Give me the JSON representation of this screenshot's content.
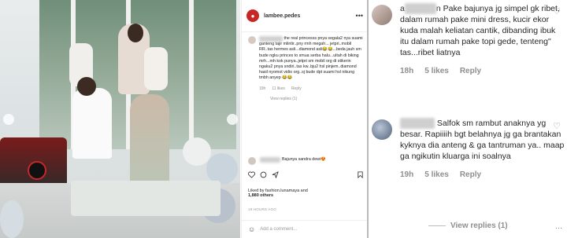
{
  "post": {
    "username": "lambee.pedes",
    "comments": [
      {
        "text": "the real princesss pnya segala2 nya suami ganteng tajir mlintir..pny rmh megah... jetpri..mobil RR..tas hermes asli...diamond asli😂😂...beda jauh sm bude ngku princes to smua serba halu...ultah di biking mrh...mh kok punya..jetpri sm mobil org di stikerin ngaku2 pnya sndiri..tas kw..bju2 hsl pinjem..diamond hasil nyomot vidio org..sj bude dpt suami hsl nikung tmbh anyep 😂😂",
        "meta": [
          "19h",
          "11 likes",
          "Reply"
        ],
        "view": "View replies (1)"
      },
      {
        "text": "Bajunya sandra dewi😍",
        "meta": []
      }
    ],
    "liked_by": "Liked by fashion.lunamaya and",
    "likes_count": "1,880 others",
    "time": "19 HOURS AGO",
    "add_comment": "Add a comment..."
  },
  "right_comments": [
    {
      "author_visible": "a",
      "author_tail": "n",
      "text": "Pake bajunya jg simpel gk ribet, dalam rumah pake mini dress, kucir ekor kuda malah keliatan cantik, dibanding ibuk itu dalam rumah pake topi gede, tenteng\" tas...ribet liatnya",
      "time": "18h",
      "likes": "5 likes",
      "reply": "Reply"
    },
    {
      "author_visible": "",
      "author_tail": "",
      "text": "Salfok sm rambut anaknya yg besar. Rapiiiih bgt belahnya jg ga brantakan kyknya dia anteng & ga tantruman ya.. maap ga ngikutin kluarga ini soalnya",
      "time": "19h",
      "likes": "5 likes",
      "reply": "Reply"
    }
  ],
  "view_replies": "View replies (1)",
  "more": "..."
}
